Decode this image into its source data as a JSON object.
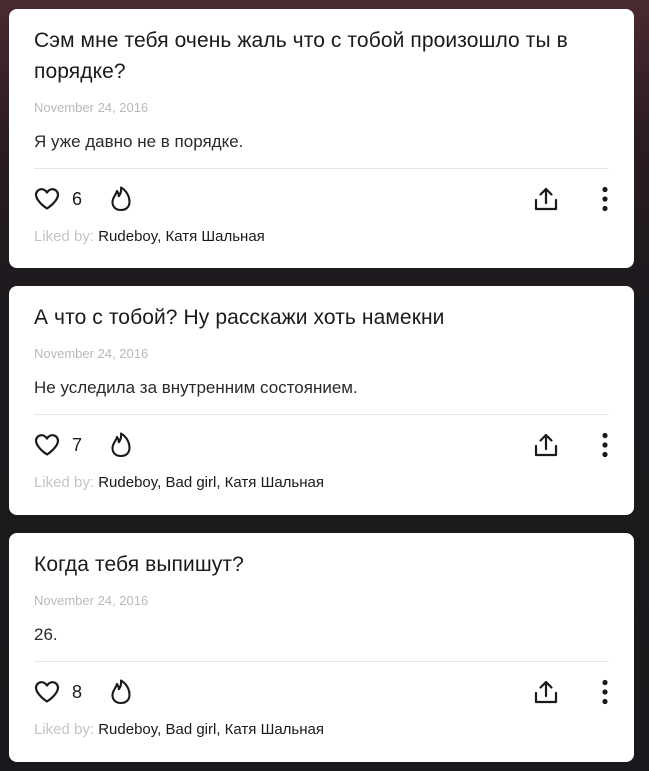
{
  "posts": [
    {
      "question": "Сэм мне тебя очень жаль что с тобой произошло ты в порядке?",
      "date": "November 24, 2016",
      "answer": "Я уже давно не в порядке.",
      "likes": "6",
      "liked_by_label": "Liked by:",
      "liked_by_names": "Rudeboy, Катя Шальная"
    },
    {
      "question": "А что с тобой? Ну расскажи хоть намекни",
      "date": "November 24, 2016",
      "answer": "Не уследила за внутренним состоянием.",
      "likes": "7",
      "liked_by_label": "Liked by:",
      "liked_by_names": "Rudeboy, Bad girl, Катя Шальная"
    },
    {
      "question": "Когда тебя выпишут?",
      "date": "November 24, 2016",
      "answer": "26.",
      "likes": "8",
      "liked_by_label": "Liked by:",
      "liked_by_names": "Rudeboy, Bad girl, Катя Шальная"
    }
  ],
  "icons": {
    "like": "heart-icon",
    "fire": "fire-icon",
    "share": "share-icon",
    "more": "more-vertical-icon"
  },
  "colors": {
    "card_bg": "#ffffff",
    "text": "#1a1a1a",
    "muted": "#b9b9b9"
  }
}
